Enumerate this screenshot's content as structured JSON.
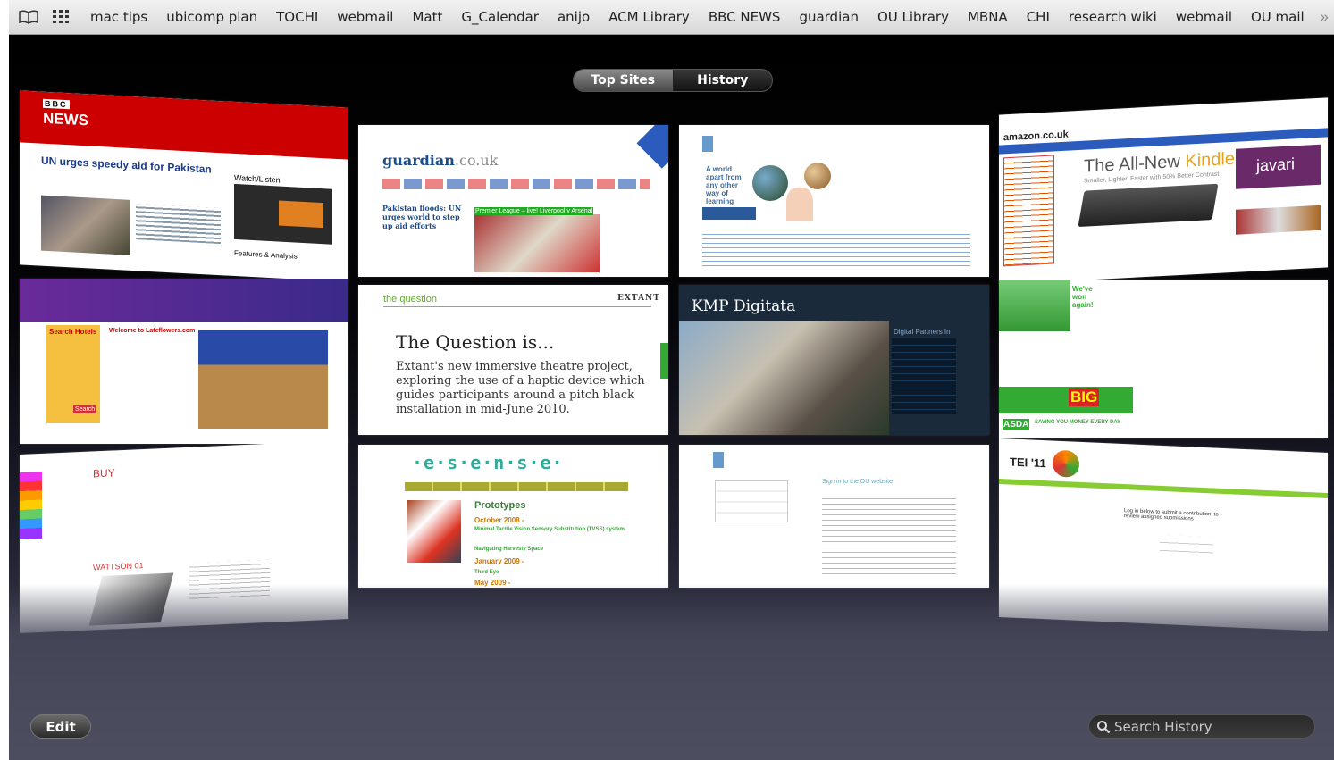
{
  "bookmarks": {
    "icons": [
      "open-book-icon",
      "grid-icon"
    ],
    "items": [
      "mac tips",
      "ubicomp plan",
      "TOCHI",
      "webmail",
      "Matt",
      "G_Calendar",
      "anijo",
      "ACM Library",
      "BBC NEWS",
      "guardian",
      "OU Library",
      "MBNA",
      "CHI",
      "research wiki",
      "webmail",
      "OU mail"
    ],
    "overflow": "»"
  },
  "view_toggle": {
    "top_sites": "Top Sites",
    "history": "History",
    "selected": "Top Sites"
  },
  "tiles": {
    "bbc": {
      "logo": "BBC",
      "section": "NEWS",
      "headline": "UN urges speedy aid for Pakistan",
      "sidebar_title": "Watch/Listen",
      "features": "Features & Analysis"
    },
    "guardian": {
      "logo": "guardian",
      "logo_suffix": ".co.uk",
      "story": "Pakistan floods: UN urges world to step up aid efforts",
      "live": "Premier League – live! Liverpool v Arsenal"
    },
    "ou": {
      "tagline": "A world apart from any other way of learning"
    },
    "amazon": {
      "logo": "amazon.co.uk",
      "headline_a": "The All-New",
      "headline_b": "Kindle",
      "subline": "Smaller, Lighter, Faster with 50% Better Contrast",
      "brand": "javari"
    },
    "lastminute": {
      "title": "Search Hotels",
      "welcome": "Welcome to Lateflowers.com",
      "button": "Search"
    },
    "question": {
      "logo": "the question",
      "brand": "EXTANT",
      "title": "The Question is...",
      "body": "Extant's new immersive theatre project, exploring the use of a haptic device which guides participants around a pitch black installation in mid-June 2010."
    },
    "kmp": {
      "logo": "KMP Digitata",
      "panel": "Digital Partners In"
    },
    "asda": {
      "bubble": "We've won again!",
      "promo": "BIG",
      "logo": "ASDA",
      "tag": "SAVING YOU MONEY EVERY DAY"
    },
    "watson": {
      "title": "BUY",
      "subtitle": "WATTSON 01"
    },
    "esense": {
      "logo": "·e·s·e·n·s·e·",
      "heading": "Prototypes",
      "items": [
        "October 2008 -",
        "Minimal Tactile Vision Sensory Substitution (TVSS) system",
        "Navigating Harvesty Space",
        "January 2009 -",
        "Third Eye",
        "May 2009 -"
      ]
    },
    "ousignin": {
      "heading": "Sign in to the OU website"
    },
    "tei": {
      "title": "TEI '11",
      "body": "Log in below to submit a contribution, to review assigned submissions"
    }
  },
  "footer": {
    "edit": "Edit",
    "search_placeholder": "Search History"
  }
}
